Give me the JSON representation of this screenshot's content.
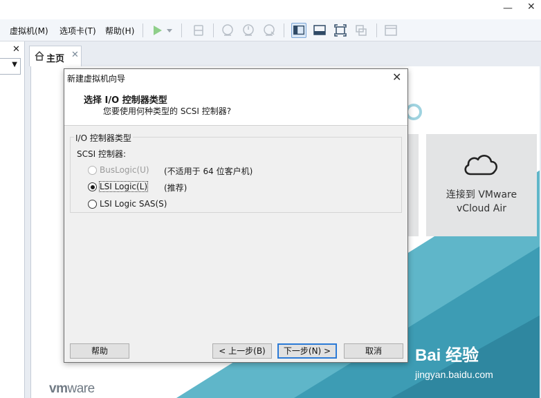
{
  "menu": {
    "vm": "虚拟机(M)",
    "tabs": "选项卡(T)",
    "help": "帮助(H)"
  },
  "window": {
    "minimize": "—",
    "close": "✕"
  },
  "library": {
    "close": "✕",
    "dropdown": "▼"
  },
  "tab": {
    "label": "主页",
    "close": "✕"
  },
  "home": {
    "tile_cloud_line1": "连接到 VMware",
    "tile_cloud_line2": "vCloud Air",
    "logo_vm": "vm",
    "logo_ware": "ware"
  },
  "watermark": {
    "brand": "Bai 经验",
    "url": "jingyan.baidu.com"
  },
  "dialog": {
    "title": "新建虚拟机向导",
    "close": "✕",
    "header_title": "选择 I/O 控制器类型",
    "header_subtitle": "您要使用何种类型的 SCSI 控制器?",
    "group_title": "I/O 控制器类型",
    "scsi_label": "SCSI 控制器:",
    "options": [
      {
        "label": "BusLogic(U)",
        "note": "(不适用于 64 位客户机)"
      },
      {
        "label": "LSI Logic(L)",
        "note": "(推荐)"
      },
      {
        "label": "LSI Logic SAS(S)",
        "note": ""
      }
    ],
    "buttons": {
      "help": "帮助",
      "back": "< 上一步(B)",
      "next": "下一步(N) >",
      "cancel": "取消"
    }
  },
  "colors": {
    "accent_teal": "#5fb6c9",
    "dialog_bg": "#f0f0f0",
    "primary_border": "#2b7ad6"
  }
}
